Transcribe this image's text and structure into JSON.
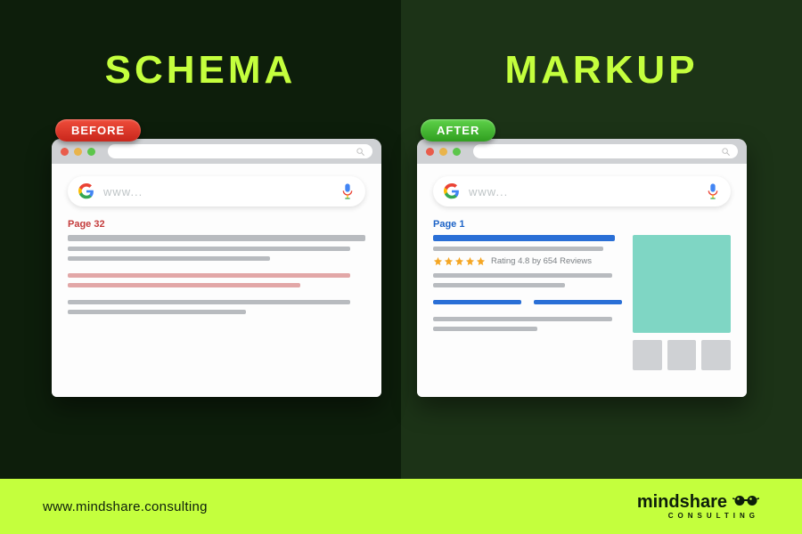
{
  "title": {
    "left": "SCHEMA",
    "right": "MARKUP"
  },
  "badges": {
    "before": "BEFORE",
    "after": "AFTER"
  },
  "browser": {
    "search_placeholder": "www...",
    "before": {
      "page_label": "Page 32"
    },
    "after": {
      "page_label": "Page 1",
      "rating_text": "Rating 4.8 by 654 Reviews",
      "stars": 5
    }
  },
  "footer": {
    "url": "www.mindshare.consulting",
    "brand_name": "mindshare",
    "brand_sub": "CONSULTING"
  },
  "colors": {
    "accent": "#c4ff3d",
    "bg_left": "#0d1e0b",
    "bg_right": "#1c3317",
    "before_badge": "#c9261b",
    "after_badge": "#2f9e1f",
    "link_blue": "#2a6fd6",
    "knowledge_panel": "#7fd6c4"
  }
}
